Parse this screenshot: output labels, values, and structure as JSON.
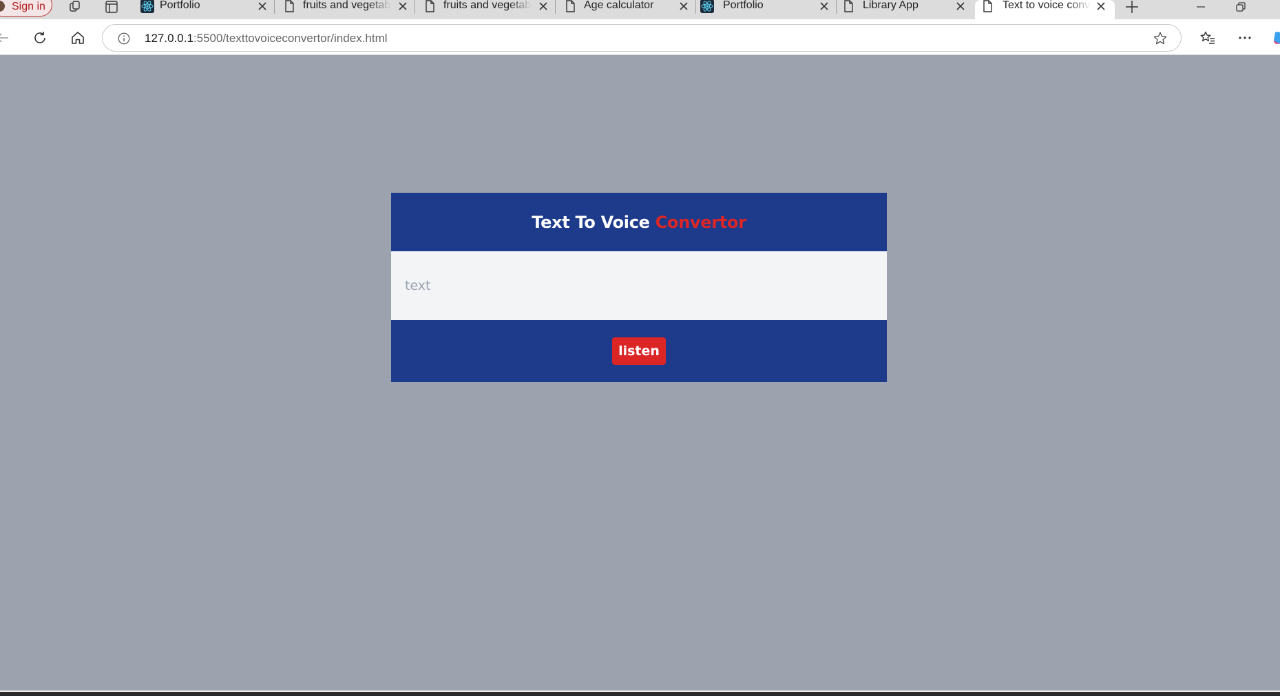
{
  "browser": {
    "signin_label": "Sign in",
    "tabs": [
      {
        "title": "Portfolio",
        "favicon": "react-icon"
      },
      {
        "title": "fruits and vegetables",
        "favicon": "page-icon"
      },
      {
        "title": "fruits and vegetables",
        "favicon": "page-icon"
      },
      {
        "title": "Age calculator",
        "favicon": "page-icon"
      },
      {
        "title": "Portfolio",
        "favicon": "react-icon"
      },
      {
        "title": "Library App",
        "favicon": "page-icon"
      },
      {
        "title": "Text to voice convertor",
        "favicon": "page-icon",
        "active": true
      }
    ],
    "address": {
      "host": "127.0.0.1",
      "rest": ":5500/texttovoiceconvertor/index.html"
    }
  },
  "app": {
    "title_main": "Text To Voice ",
    "title_accent": "Convertor",
    "input_placeholder": "text",
    "input_value": "",
    "listen_label": "listen"
  },
  "colors": {
    "page_bg": "#9ca3af",
    "header_bg": "#1e3a8a",
    "accent": "#dc2626",
    "input_bg": "#f3f4f6"
  }
}
